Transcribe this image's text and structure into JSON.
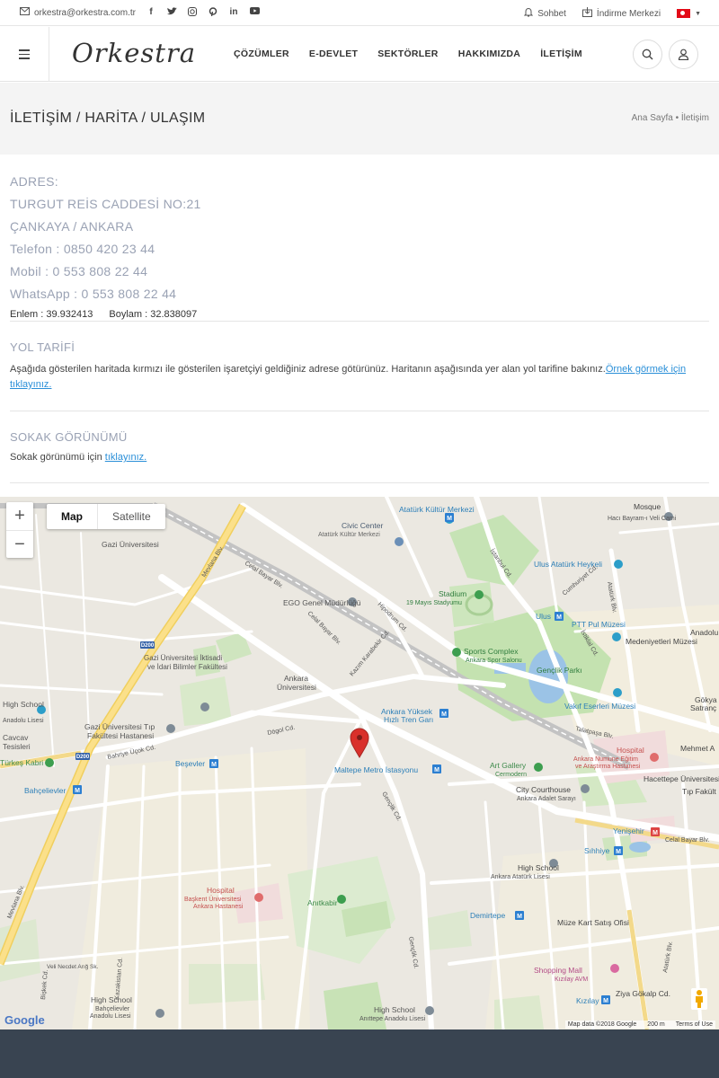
{
  "topbar": {
    "email": "orkestra@orkestra.com.tr",
    "socials": [
      "facebook-icon",
      "twitter-icon",
      "instagram-icon",
      "pinterest-icon",
      "linkedin-icon",
      "youtube-icon"
    ],
    "chat": "Sohbet",
    "download": "İndirme Merkezi",
    "language_flag": "turkey-flag-icon"
  },
  "header": {
    "logo": "Orkestra",
    "nav": [
      "ÇÖZÜMLER",
      "E-DEVLET",
      "SEKTÖRLER",
      "HAKKIMIZDA",
      "İLETİŞİM"
    ]
  },
  "page": {
    "title": "İLETİŞİM / HARİTA / ULAŞIM",
    "breadcrumb_home": "Ana Sayfa",
    "breadcrumb_sep": "•",
    "breadcrumb_current": "İletişim"
  },
  "address": {
    "label": "ADRES:",
    "line1": "TURGUT REİS CADDESİ NO:21",
    "line2": "ÇANKAYA / ANKARA",
    "phone": "Telefon : 0850 420 23 44",
    "mobile": "Mobil : 0 553 808 22 44",
    "whatsapp": "WhatsApp : 0 553 808 22 44",
    "lat": "Enlem : 39.932413",
    "lng": "Boylam : 32.838097"
  },
  "directions": {
    "title": "YOL TARİFİ",
    "text": "Aşağıda gösterilen haritada kırmızı ile gösterilen işaretçiyi geldiğiniz adrese götürünüz. Haritanın aşağısında yer alan yol tarifine bakınız.",
    "link": "Örnek görmek için tıklayınız."
  },
  "street": {
    "title": "SOKAK GÖRÜNÜMÜ",
    "text": "Sokak görünümü için ",
    "link": "tıklayınız."
  },
  "map": {
    "type_map": "Map",
    "type_satellite": "Satellite",
    "zoom_in": "+",
    "zoom_out": "−",
    "google": "Google",
    "data": "Map data ©2018 Google",
    "scale": "200 m",
    "terms": "Terms of Use",
    "labels": {
      "ataturk_kultur": "Atatürk Kültür Merkezi",
      "civic_center": "Civic Center",
      "civic_sub": "Atatürk Kültür Merkezi",
      "haci_bayram": "Hacı Bayram-ı Veli Cami",
      "mosque": "Mosque",
      "gazi_uni": "Gazi Üniversitesi",
      "ulus_heykeli": "Ulus Atatürk Heykeli",
      "stadium": "Stadium",
      "stadium_sub": "19 Mayıs Stadyumu",
      "ego": "EGO Genel Müdürlüğü",
      "ulus": "Ulus",
      "ptt": "PTT Pul Müzesi",
      "anadolu": "Anadolu",
      "medeniyetler": "Medeniyetleri Müzesi",
      "sports_complex": "Sports Complex",
      "sports_sub": "Ankara Spor Salonu",
      "genclik_parki": "Gençlik Parkı",
      "gazi_iktisadi": "Gazi Üniversitesi İktisadi",
      "gazi_iktisadi2": "ve İdari Bilimler Fakültesi",
      "ankara_uni": "Ankara",
      "ankara_uni2": "Üniversitesi",
      "vakif": "Vakıf Eserleri Müzesi",
      "gokyay": "Gökya",
      "gokyay2": "Satranç M",
      "high_school": "High School",
      "high_school_sub": "Anadolu Lisesi",
      "yht": "Ankara Yüksek",
      "yht2": "Hızlı Tren Garı",
      "gazi_tip": "Gazi Üniversitesi Tıp",
      "gazi_tip2": "Fakültesi Hastanesi",
      "cavcav": "Cavcav",
      "cavcav2": "Tesisleri",
      "mehmet": "Mehmet A",
      "hospital": "Hospital",
      "numune": "Ankara Numune Eğitim",
      "numune2": "ve Araştırma Hastanesi",
      "turkes": "Türkeş Kabri",
      "besevler": "Beşevler",
      "maltepe": "Maltepe Metro İstasyonu",
      "art_gallery": "Art Gallery",
      "cermodern": "Cermodern",
      "hacettepe": "Hacettepe Üniversitesi",
      "hacettepe2": "Tıp Fakült",
      "bahcelievler": "Bahçelievler",
      "city_courthouse": "City Courthouse",
      "courthouse_sub": "Ankara Adalet Sarayı",
      "yenisehir": "Yenişehir",
      "sihhiye": "Sıhhiye",
      "high_school2": "High School",
      "high_school2_sub": "Ankara Atatürk Lisesi",
      "hospital2": "Hospital",
      "baskent": "Başkent Üniversitesi",
      "baskent2": "Ankara Hastanesi",
      "anitkabir": "Anıtkabir",
      "demirtepe": "Demirtepe",
      "muze_kart": "Müze Kart Satış Ofisi",
      "shopping_mall": "Shopping Mall",
      "kizilay_avm": "Kızılay AVM",
      "kizilay": "Kızılay",
      "ziya": "Ziya Gökalp Cd.",
      "high_school3": "High School",
      "high_school3_sub": "Bahçelievler",
      "high_school3_sub2": "Anadolu Lisesi",
      "high_school4": "High School",
      "high_school4_sub": "Anıttepe Anadolu Lisesi",
      "mevlana": "Mevlana Blv.",
      "celal_bayar": "Celal Bayar Blv.",
      "celal_bayar2": "Celal Bayar Blv.",
      "celal_bayar3": "Celal Bayar Blv.",
      "hipodrum": "Hipodrum Cd.",
      "talatpasa": "Talatpaşa Blv.",
      "dogol": "Dögol Cd.",
      "genclik": "Gençlik Cd.",
      "kazim": "Kazım Karabekir Cd.",
      "bahriye": "Bahriye Üçok Cd.",
      "istanbul": "İstanbul Cd.",
      "d200": "D200",
      "d200b": "D200",
      "kazakistan": "Kazakistan Cd.",
      "biskek": "Bişkek Cd.",
      "veli_necdet": "Veli Necdet Arığ Sk.",
      "cumhuriyet": "Cumhuriyet Cd.",
      "ataturk_blv": "Atatürk Blv.",
      "istiklal": "İstiklal Cd."
    }
  },
  "colors": {
    "accent_link": "#2a8fd8",
    "muted_heading": "#9aa2b4",
    "footer": "#394451",
    "map_pin": "#d9302b"
  }
}
